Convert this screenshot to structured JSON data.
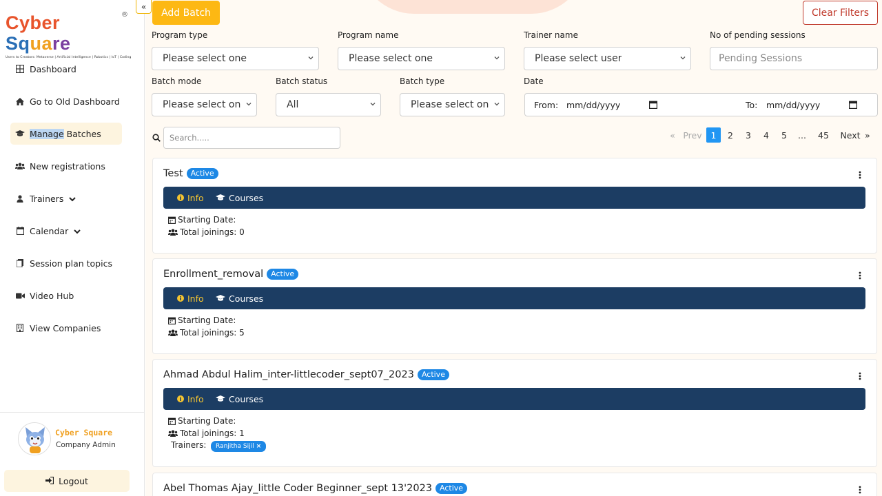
{
  "logo": {
    "part1": "Cyber",
    "part2": "Sq",
    "part3": "ua",
    "part4": "re",
    "reg": "®",
    "tagline": "Users to Creators: Metaverse | Artificial Intelligence | Robotics | IoT | Coding"
  },
  "sidebar": {
    "collapse_icon": "«",
    "items": [
      {
        "label": "Dashboard",
        "icon": "dashboard-icon"
      },
      {
        "label": "Go to Old Dashboard",
        "icon": "home-icon"
      },
      {
        "label_highlight": "Manage",
        "label_rest": " Batches",
        "icon": "graduation-cap-icon"
      },
      {
        "label": "New registrations",
        "icon": "users-icon"
      },
      {
        "label": "Trainers",
        "icon": "user-icon"
      },
      {
        "label": "Calendar",
        "icon": "calendar-icon"
      },
      {
        "label": "Session plan topics",
        "icon": "document-icon"
      },
      {
        "label": "Video Hub",
        "icon": "video-icon"
      },
      {
        "label": "View Companies",
        "icon": "building-icon"
      }
    ]
  },
  "profile": {
    "name": "Cyber Square",
    "role": "Company Admin",
    "logout": "Logout"
  },
  "toolbar": {
    "add_batch": "Add Batch",
    "clear_filters": "Clear Filters"
  },
  "filters": {
    "program_type": {
      "label": "Program type",
      "value": "Please select one"
    },
    "program_name": {
      "label": "Program name",
      "value": "Please select one"
    },
    "trainer_name": {
      "label": "Trainer name",
      "value": "Please select user"
    },
    "pending": {
      "label": "No of pending sessions",
      "placeholder": "Pending Sessions"
    },
    "batch_mode": {
      "label": "Batch mode",
      "value": "Please select one"
    },
    "batch_status": {
      "label": "Batch status",
      "value": "All"
    },
    "batch_type": {
      "label": "Batch type",
      "value": "Please select one"
    },
    "date": {
      "label": "Date",
      "from_label": "From:",
      "from_value": "mm/dd/yyyy",
      "to_label": "To:",
      "to_value": "mm/dd/yyyy"
    }
  },
  "search": {
    "placeholder": "Search....."
  },
  "pagination": {
    "prev_arrow": "«",
    "prev": "Prev",
    "pages": [
      "1",
      "2",
      "3",
      "4",
      "5"
    ],
    "current": "1",
    "ellipsis": "...",
    "last": "45",
    "next": "Next",
    "next_arrow": "»"
  },
  "batches": [
    {
      "title": "Test",
      "status": "Active",
      "tab_info": "Info",
      "tab_courses": "Courses",
      "starting_date": "Starting Date:",
      "total_joinings": "Total joinings: 0"
    },
    {
      "title": "Enrollment_removal",
      "status": "Active",
      "tab_info": "Info",
      "tab_courses": "Courses",
      "starting_date": "Starting Date:",
      "total_joinings": "Total joinings: 5"
    },
    {
      "title": "Ahmad Abdul Halim_inter-littlecoder_sept07_2023",
      "status": "Active",
      "tab_info": "Info",
      "tab_courses": "Courses",
      "starting_date": "Starting Date:",
      "total_joinings": "Total joinings: 1",
      "trainers_label": "Trainers:",
      "trainer": "Ranjitha Sijil"
    },
    {
      "title": "Abel Thomas Ajay_little Coder Beginner_sept 13'2023",
      "status": "Active"
    }
  ],
  "colors": {
    "accent": "#fdb813",
    "navy": "#1c3d63",
    "badge": "#1e88e5",
    "danger": "#c0392b"
  }
}
